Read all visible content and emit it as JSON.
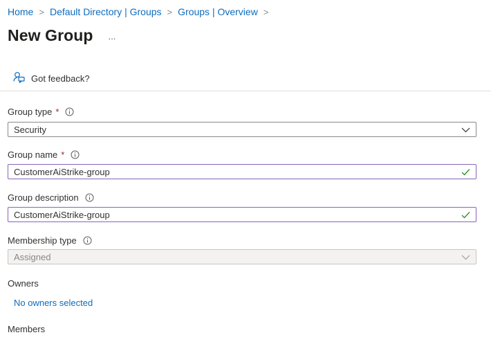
{
  "breadcrumb": {
    "items": [
      "Home",
      "Default Directory | Groups",
      "Groups | Overview"
    ],
    "separator": ">"
  },
  "header": {
    "title": "New Group",
    "more": "..."
  },
  "feedback": {
    "label": "Got feedback?"
  },
  "form": {
    "group_type": {
      "label": "Group type",
      "required_mark": "*",
      "value": "Security"
    },
    "group_name": {
      "label": "Group name",
      "required_mark": "*",
      "value": "CustomerAiStrike-group"
    },
    "group_description": {
      "label": "Group description",
      "value": "CustomerAiStrike-group"
    },
    "membership_type": {
      "label": "Membership type",
      "value": "Assigned"
    },
    "owners": {
      "label": "Owners",
      "link": "No owners selected"
    },
    "members": {
      "label": "Members"
    }
  },
  "colors": {
    "link": "#0f6cbd",
    "required": "#a4262c",
    "valid_border": "#8764b8",
    "check": "#107c10"
  }
}
